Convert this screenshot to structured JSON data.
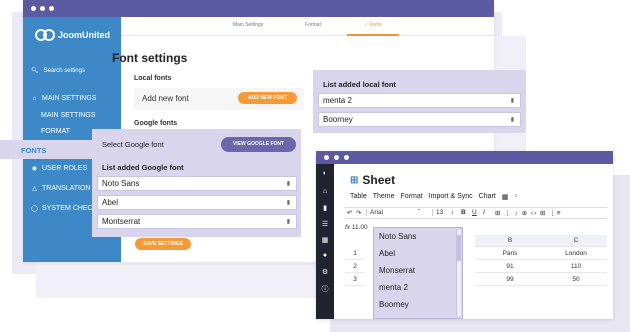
{
  "colors": {
    "titlebar": "#5c5aa3",
    "sidebar": "#3d88c7",
    "accent_orange": "#f29333",
    "panel_purple": "#d8d5ec",
    "sheet_sidebar": "#1f2430"
  },
  "main_window": {
    "logo_text": "JoomUnited",
    "search_placeholder": "Search settings",
    "sidebar": {
      "main_settings": "MAIN SETTINGS",
      "main_settings_sub": "MAIN SETTINGS",
      "format": "FORMAT",
      "fonts": "FONTS",
      "user_roles": "USER ROLES",
      "translation": "TRANSLATION",
      "system_check": "SYSTEM CHEC"
    },
    "tabs": [
      "Main Settings",
      "Format",
      "Fonts"
    ],
    "active_tab_index": 2,
    "heading": "Font settings",
    "local_fonts_label": "Local fonts",
    "add_new_font_label": "Add new font",
    "add_new_font_button": "ADD NEW FONT",
    "google_fonts_label": "Google fonts",
    "save_button": "SAVE SETTINGS"
  },
  "google_panel": {
    "select_label": "Select Google font",
    "view_button": "VIEW GOOGLE FONT",
    "list_title": "List added Google font",
    "fonts": [
      "Noto Sans",
      "Abel",
      "Montserrat"
    ]
  },
  "local_panel": {
    "list_title": "List added local font",
    "fonts": [
      "menta 2",
      "Boorney"
    ]
  },
  "sheet_window": {
    "title": "Sheet",
    "sidebar_icons": [
      "toggle-icon",
      "home-icon",
      "file-icon",
      "list-icon",
      "puzzle-icon",
      "users-icon",
      "wrench-icon",
      "info-icon"
    ],
    "menu": [
      "Table",
      "Theme",
      "Format",
      "Import & Sync",
      "Chart"
    ],
    "toolbar": {
      "undo": "↶",
      "redo": "↷",
      "font_value": "Arial",
      "size_value": "13",
      "bold": "B",
      "underline": "U",
      "italic": "I",
      "more": "⊞ ⋮ ↕ ⊕ ‹› ⊞ ⋮≡"
    },
    "formula_prefix": "fx",
    "formula_value": "11.00",
    "columns": [
      "B",
      "C"
    ],
    "rows": [
      {
        "num": "1",
        "b": "Paris",
        "c": "London"
      },
      {
        "num": "2",
        "b": "91",
        "c": "110"
      },
      {
        "num": "3",
        "b": "99",
        "c": "50"
      }
    ],
    "font_dropdown": [
      "Noto Sans",
      "Abel",
      "Monserrat",
      "menta 2",
      "Boorney"
    ]
  }
}
